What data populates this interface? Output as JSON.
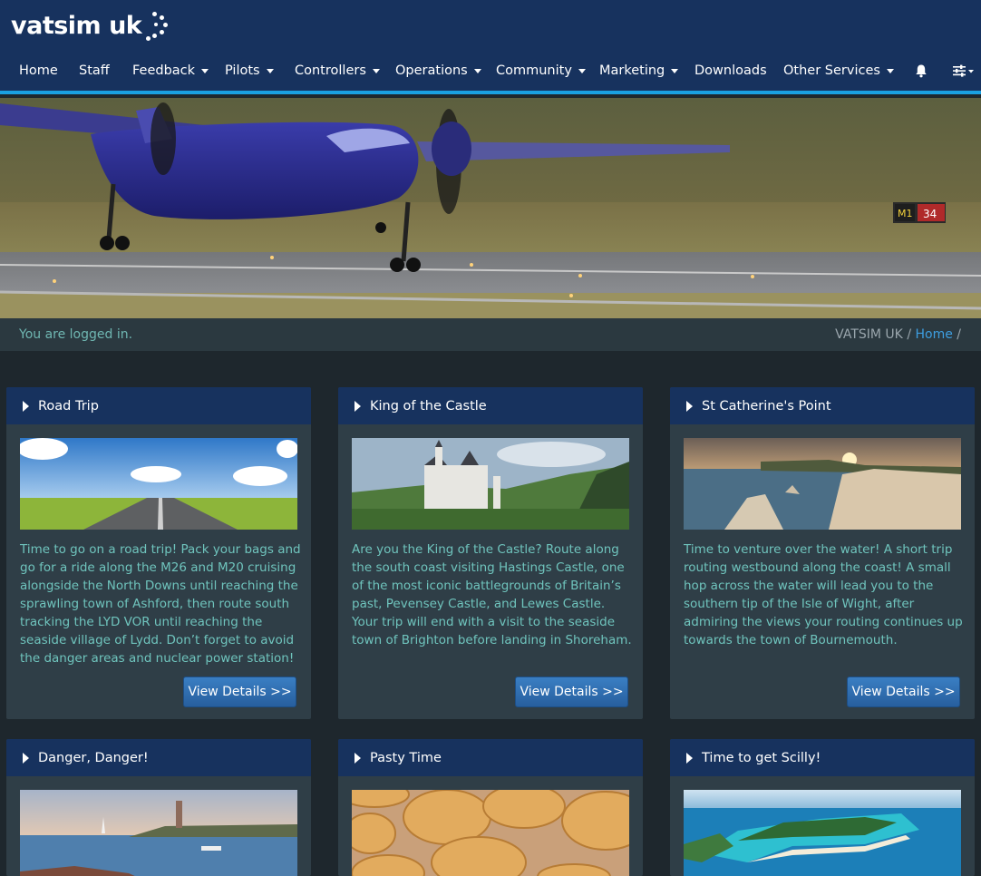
{
  "brand": {
    "name": "vatsim uk"
  },
  "nav": {
    "items": [
      {
        "label": "Home",
        "dropdown": false
      },
      {
        "label": "Staff",
        "dropdown": false
      },
      {
        "label": "Feedback",
        "dropdown": true
      },
      {
        "label": "Pilots",
        "dropdown": true
      },
      {
        "label": "Controllers",
        "dropdown": true
      },
      {
        "label": "Operations",
        "dropdown": true
      },
      {
        "label": "Community",
        "dropdown": true
      },
      {
        "label": "Marketing",
        "dropdown": true
      },
      {
        "label": "Downloads",
        "dropdown": false
      },
      {
        "label": "Other Services",
        "dropdown": true
      }
    ],
    "icons": [
      "bell-icon",
      "sliders-icon"
    ]
  },
  "hero": {
    "runway_sign": {
      "left": "M1",
      "right": "34"
    }
  },
  "status": {
    "message": "You are logged in.",
    "breadcrumb": {
      "root": "VATSIM UK",
      "separator": "/",
      "current": "Home",
      "trailing": "/"
    }
  },
  "cards": [
    {
      "title": "Road Trip",
      "text": "Time to go on a road trip! Pack your bags and go for a ride along the M26 and M20 cruising alongside the North Downs until reaching the sprawling town of Ashford, then route south tracking the LYD VOR until reaching the seaside village of Lydd. Don’t forget to avoid the danger areas and nuclear power station!",
      "button": "View Details >>"
    },
    {
      "title": "King of the Castle",
      "text": "Are you the King of the Castle? Route along the south coast visiting Hastings Castle, one of the most iconic battlegrounds of Britain’s past, Pevensey Castle, and Lewes Castle. Your trip will end with a visit to the seaside town of Brighton before landing in Shoreham.",
      "button": "View Details >>"
    },
    {
      "title": "St Catherine's Point",
      "text": "Time to venture over the water! A short trip routing westbound along the coast! A small hop across the water will lead you to the southern tip of the Isle of Wight, after admiring the views your routing continues up towards the town of Bournemouth.",
      "button": "View Details >>"
    },
    {
      "title": "Danger, Danger!"
    },
    {
      "title": "Pasty Time"
    },
    {
      "title": "Time to get Scilly!"
    }
  ],
  "colors": {
    "header": "#17325e",
    "accent": "#1aa0e0",
    "page": "#1e272d",
    "card": "#2f3e47",
    "card_text": "#6fc4bd",
    "link": "#3d9ee0"
  }
}
